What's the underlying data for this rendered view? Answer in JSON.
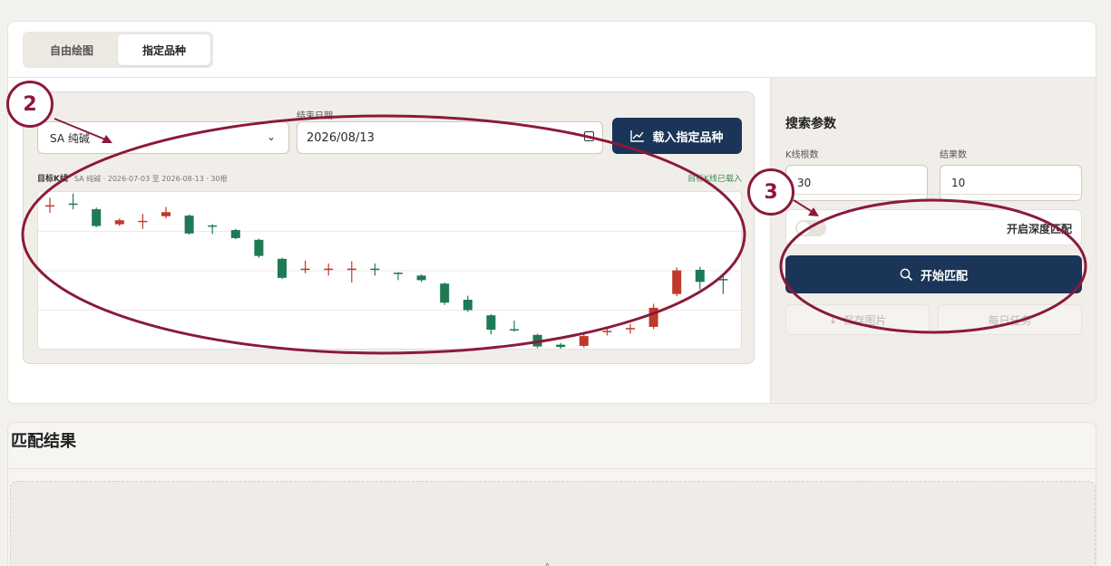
{
  "tabs": [
    {
      "label": "自由绘图",
      "active": false
    },
    {
      "label": "指定品种",
      "active": true
    }
  ],
  "form": {
    "symbol_value": "SA 纯碱",
    "end_date_label": "结束日期",
    "end_date_value": "2026/08/13",
    "load_button": "载入指定品种"
  },
  "chart_header": {
    "title": "目标K线",
    "subtitle": "SA 纯碱 · 2026-07-03 至 2026-08-13 · 30根",
    "status": "目标K线已载入"
  },
  "chart_data": {
    "type": "candlestick",
    "bar_count": 30,
    "candles": [
      {
        "open": 100,
        "close": 100.2,
        "high": 101.5,
        "low": 98.9
      },
      {
        "open": 100.5,
        "close": 100.4,
        "high": 102.2,
        "low": 99.5
      },
      {
        "open": 99.5,
        "close": 96.6,
        "high": 99.8,
        "low": 96.4
      },
      {
        "open": 96.9,
        "close": 97.6,
        "high": 97.9,
        "low": 96.6
      },
      {
        "open": 97.4,
        "close": 97.5,
        "high": 98.7,
        "low": 96.1
      },
      {
        "open": 98.3,
        "close": 99.0,
        "high": 99.9,
        "low": 97.9
      },
      {
        "open": 98.4,
        "close": 95.3,
        "high": 98.6,
        "low": 95.1
      },
      {
        "open": 96.7,
        "close": 96.6,
        "high": 96.9,
        "low": 95.2
      },
      {
        "open": 95.9,
        "close": 94.5,
        "high": 96.1,
        "low": 94.3
      },
      {
        "open": 94.2,
        "close": 91.4,
        "high": 94.4,
        "low": 91.1
      },
      {
        "open": 90.9,
        "close": 87.6,
        "high": 91.1,
        "low": 87.4
      },
      {
        "open": 89.0,
        "close": 89.2,
        "high": 90.6,
        "low": 88.4
      },
      {
        "open": 89.1,
        "close": 89.2,
        "high": 90.1,
        "low": 88.0
      },
      {
        "open": 89.0,
        "close": 89.2,
        "high": 90.5,
        "low": 86.8
      },
      {
        "open": 89.2,
        "close": 89.0,
        "high": 90.1,
        "low": 88.0
      },
      {
        "open": 88.5,
        "close": 88.4,
        "high": 88.6,
        "low": 87.2
      },
      {
        "open": 88.0,
        "close": 87.2,
        "high": 88.2,
        "low": 86.9
      },
      {
        "open": 86.6,
        "close": 83.3,
        "high": 86.8,
        "low": 82.9
      },
      {
        "open": 83.8,
        "close": 82.0,
        "high": 84.5,
        "low": 81.7
      },
      {
        "open": 81.1,
        "close": 78.6,
        "high": 81.3,
        "low": 77.8
      },
      {
        "open": 78.7,
        "close": 78.5,
        "high": 80.2,
        "low": 78.3
      },
      {
        "open": 77.7,
        "close": 75.7,
        "high": 77.9,
        "low": 75.4
      },
      {
        "open": 76.0,
        "close": 75.6,
        "high": 76.3,
        "low": 74.6
      },
      {
        "open": 75.8,
        "close": 77.5,
        "high": 77.9,
        "low": 75.5
      },
      {
        "open": 78.3,
        "close": 78.4,
        "high": 79.0,
        "low": 77.6
      },
      {
        "open": 78.8,
        "close": 78.9,
        "high": 79.6,
        "low": 77.9
      },
      {
        "open": 79.1,
        "close": 82.4,
        "high": 83.1,
        "low": 78.7
      },
      {
        "open": 84.8,
        "close": 88.9,
        "high": 89.4,
        "low": 84.4
      },
      {
        "open": 89.0,
        "close": 86.9,
        "high": 89.5,
        "low": 85.6
      },
      {
        "open": 87.4,
        "close": 87.2,
        "high": 88.4,
        "low": 84.8
      }
    ],
    "up_color": "#c0392b",
    "down_color": "#1e7a55",
    "grid": true,
    "ylim": [
      75,
      102.5
    ]
  },
  "params": {
    "title": "搜索参数",
    "kline_label": "K线根数",
    "kline_value": "30",
    "results_label": "结果数",
    "results_value": "10",
    "deep_match_label": "开启深度匹配",
    "deep_match_on": false,
    "start_button": "开始匹配",
    "save_image_button": "保存图片",
    "daily_task_button": "每日任务"
  },
  "results": {
    "title": "匹配结果"
  },
  "annotations": {
    "badge_2": "2",
    "badge_3": "3",
    "color": "#8b1a3a"
  },
  "colors": {
    "primary": "#1b3558",
    "accent_green": "#3a8a54"
  }
}
